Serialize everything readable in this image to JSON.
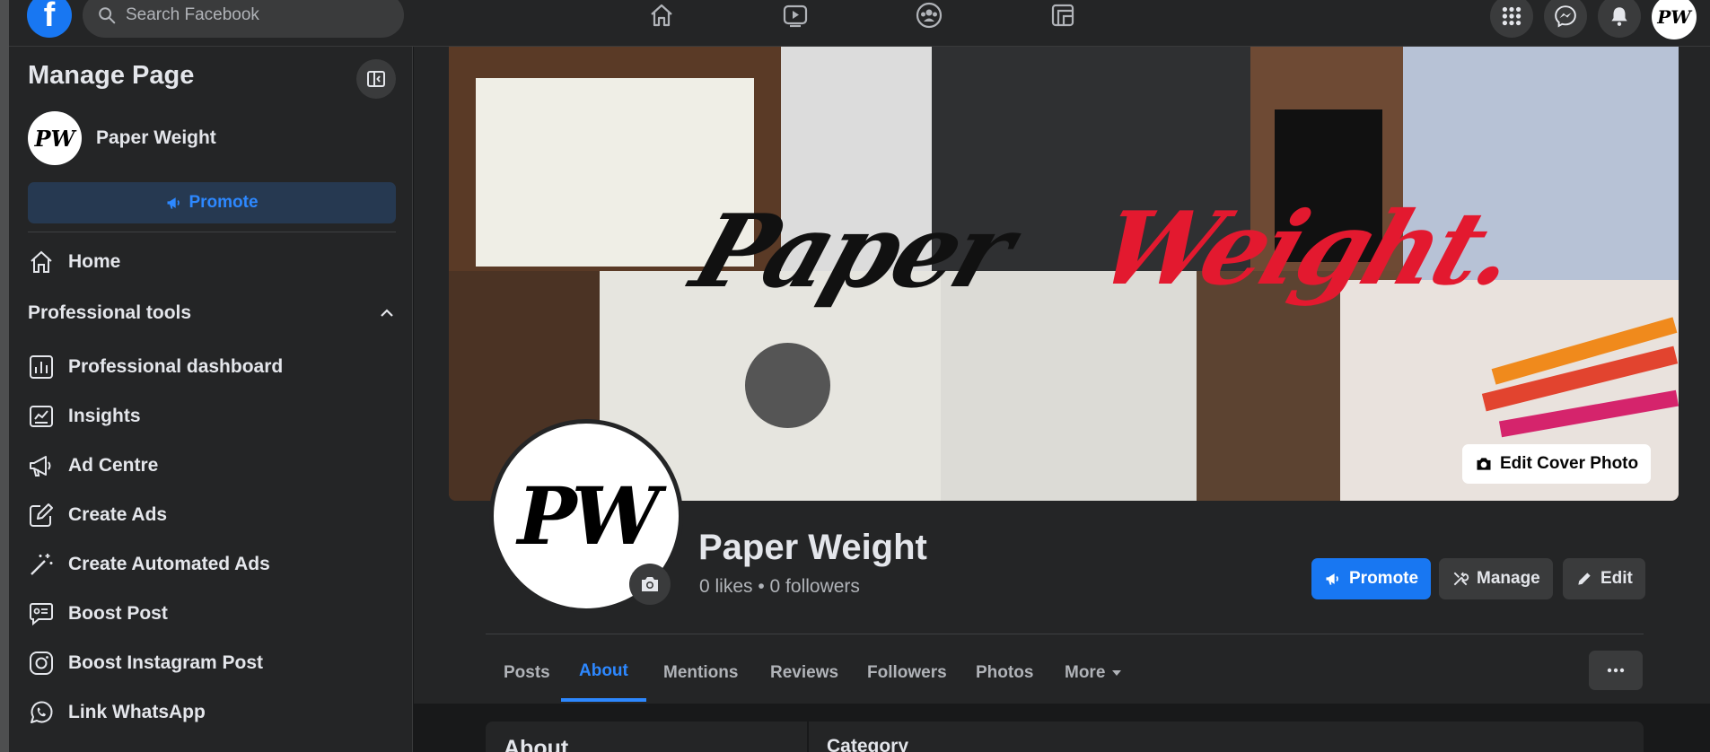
{
  "topbar": {
    "logo": "f",
    "search_placeholder": "Search Facebook",
    "icons": [
      "home-icon",
      "watch-icon",
      "groups-icon",
      "gaming-icon"
    ],
    "right_icons": [
      "menu-grid-icon",
      "messenger-icon",
      "notifications-icon"
    ],
    "avatar_text": "PW"
  },
  "sidebar": {
    "title": "Manage Page",
    "page_name": "Paper Weight",
    "avatar_text": "PW",
    "promote_label": "Promote",
    "home_label": "Home",
    "section_label": "Professional tools",
    "items": [
      {
        "label": "Professional dashboard",
        "icon": "dashboard-icon"
      },
      {
        "label": "Insights",
        "icon": "insights-icon"
      },
      {
        "label": "Ad Centre",
        "icon": "megaphone-icon"
      },
      {
        "label": "Create Ads",
        "icon": "pencil-square-icon"
      },
      {
        "label": "Create Automated Ads",
        "icon": "magic-wand-icon"
      },
      {
        "label": "Boost Post",
        "icon": "boost-post-icon"
      },
      {
        "label": "Boost Instagram Post",
        "icon": "instagram-icon"
      },
      {
        "label": "Link WhatsApp",
        "icon": "whatsapp-icon"
      }
    ]
  },
  "cover": {
    "title_black": "Paper",
    "title_red": "Weight.",
    "edit_label": "Edit Cover Photo"
  },
  "profile": {
    "avatar_text": "PW",
    "name": "Paper Weight",
    "stats": "0 likes • 0 followers"
  },
  "actions": {
    "promote": "Promote",
    "manage": "Manage",
    "edit": "Edit"
  },
  "tabs": [
    "Posts",
    "About",
    "Mentions",
    "Reviews",
    "Followers",
    "Photos",
    "More"
  ],
  "active_tab": "About",
  "content": {
    "about_heading": "About",
    "category_heading": "Category"
  },
  "colors": {
    "accent": "#2d88ff",
    "primary_button": "#1877f2",
    "surface": "#242526",
    "background": "#18191a",
    "cover_red": "#e3192f"
  }
}
